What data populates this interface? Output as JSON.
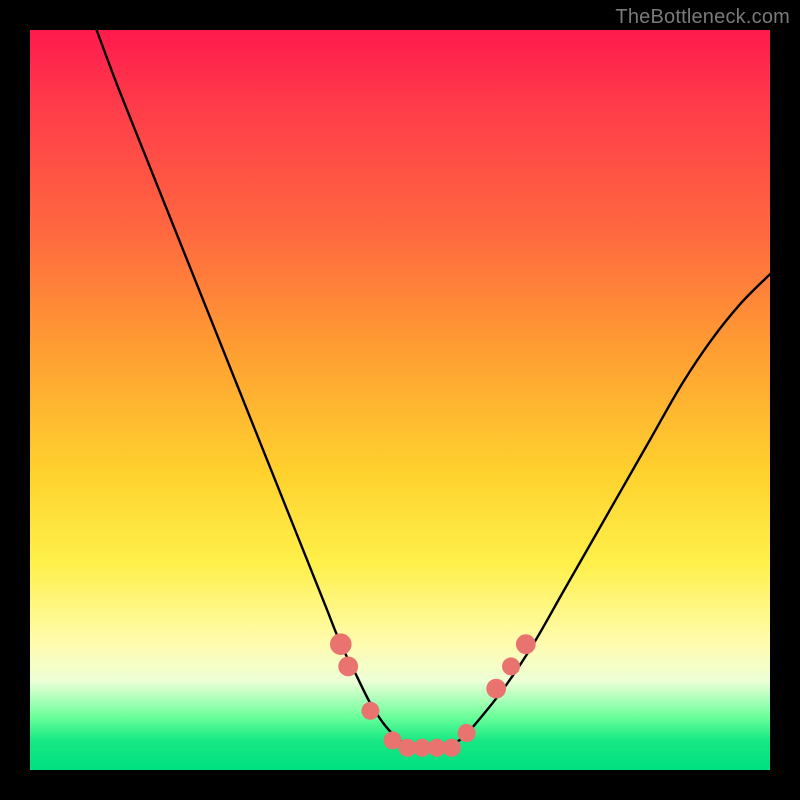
{
  "watermark": "TheBottleneck.com",
  "colors": {
    "background": "#000000",
    "gradient_top": "#ff1a4d",
    "gradient_mid": "#ffd22e",
    "gradient_bottom": "#00e080",
    "curve": "#000000",
    "markers": "#e9746f"
  },
  "chart_data": {
    "type": "line",
    "title": "",
    "xlabel": "",
    "ylabel": "",
    "xlim": [
      0,
      100
    ],
    "ylim": [
      0,
      100
    ],
    "series": [
      {
        "name": "curve",
        "x": [
          9,
          12,
          16,
          20,
          24,
          28,
          32,
          36,
          38,
          40,
          42,
          44,
          46,
          48,
          50,
          52,
          54,
          56,
          58,
          60,
          64,
          68,
          72,
          76,
          80,
          84,
          88,
          92,
          96,
          100
        ],
        "y": [
          100,
          92,
          82,
          72,
          62,
          52,
          42,
          32,
          27,
          22,
          17,
          13,
          9,
          6,
          4,
          3,
          3,
          3,
          4,
          6,
          11,
          17,
          24,
          31,
          38,
          45,
          52,
          58,
          63,
          67
        ]
      }
    ],
    "markers": [
      {
        "x": 42,
        "y": 17,
        "r": 2.4
      },
      {
        "x": 43,
        "y": 14,
        "r": 2.2
      },
      {
        "x": 46,
        "y": 8,
        "r": 2.0
      },
      {
        "x": 49,
        "y": 4,
        "r": 2.0
      },
      {
        "x": 51,
        "y": 3,
        "r": 2.0
      },
      {
        "x": 53,
        "y": 3,
        "r": 2.0
      },
      {
        "x": 55,
        "y": 3,
        "r": 2.0
      },
      {
        "x": 57,
        "y": 3,
        "r": 2.0
      },
      {
        "x": 59,
        "y": 5,
        "r": 2.0
      },
      {
        "x": 63,
        "y": 11,
        "r": 2.2
      },
      {
        "x": 65,
        "y": 14,
        "r": 2.0
      },
      {
        "x": 67,
        "y": 17,
        "r": 2.2
      }
    ]
  }
}
